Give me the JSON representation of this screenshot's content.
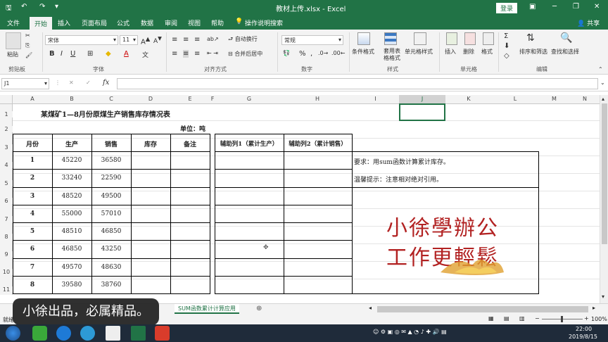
{
  "window": {
    "title": "教材上传.xlsx - Excel",
    "login": "登录"
  },
  "tabs": [
    "文件",
    "开始",
    "插入",
    "页面布局",
    "公式",
    "数据",
    "审阅",
    "视图",
    "帮助"
  ],
  "active_tab": "开始",
  "tell_me": "操作说明搜索",
  "share": "共享",
  "ribbon": {
    "paste": "粘贴",
    "clipboard": "剪贴板",
    "font_name": "宋体",
    "font_size": "11",
    "font": "字体",
    "wrap": "自动换行",
    "merge": "合并后居中",
    "alignment": "对齐方式",
    "number_format": "常规",
    "number": "数字",
    "cond_format": "条件格式",
    "table_format": "套用表格格式",
    "cell_styles": "单元格样式",
    "styles": "样式",
    "insert": "插入",
    "delete": "删除",
    "format": "格式",
    "cells": "单元格",
    "sort_filter": "排序和筛选",
    "find_select": "查找和选择",
    "editing": "编辑"
  },
  "formula_bar": {
    "name_box": "J1",
    "fx": "fx",
    "value": ""
  },
  "columns": [
    "A",
    "B",
    "C",
    "D",
    "E",
    "F",
    "G",
    "H",
    "I",
    "J",
    "K",
    "L",
    "M",
    "N"
  ],
  "rows": [
    "1",
    "2",
    "3",
    "4",
    "5",
    "6",
    "7",
    "8",
    "9",
    "10",
    "11"
  ],
  "sheet": {
    "title": "某煤矿1—8月份原煤生产销售库存情况表",
    "unit": "单位：吨",
    "headers": [
      "月份",
      "生产",
      "销售",
      "库存",
      "备注"
    ],
    "helper1": "辅助列1（累计生产）",
    "helper2": "辅助列2（累计销售）",
    "data": [
      [
        "1",
        "45220",
        "36580"
      ],
      [
        "2",
        "33240",
        "22590"
      ],
      [
        "3",
        "48520",
        "49500"
      ],
      [
        "4",
        "55000",
        "57010"
      ],
      [
        "5",
        "48510",
        "46850"
      ],
      [
        "6",
        "46850",
        "43250"
      ],
      [
        "7",
        "49570",
        "48630"
      ],
      [
        "8",
        "39580",
        "38760"
      ]
    ],
    "requirement": "要求：用sum函数计算累计库存。",
    "tip": "温馨提示：注意相对绝对引用。",
    "brand_line1": "小徐學辦公",
    "brand_line2": "工作更輕鬆"
  },
  "sheet_tab": "SUM函数累计计算应用",
  "subtitle": "小徐出品，必属精品。",
  "status": {
    "ready": "就绪",
    "zoom": "100%"
  },
  "clock": {
    "time": "22:00",
    "date": "2019/8/15"
  },
  "colors": {
    "excel_green": "#217346",
    "brand_red": "#b22222"
  }
}
